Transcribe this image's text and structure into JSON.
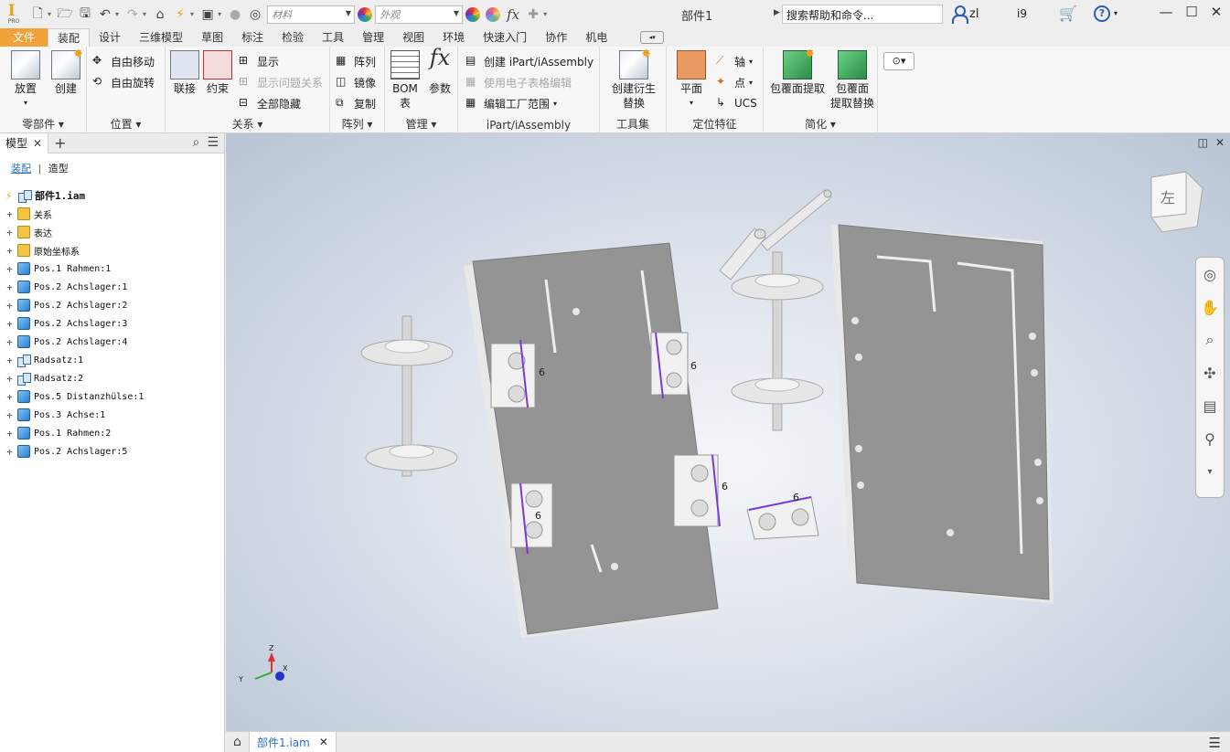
{
  "titlebar": {
    "logo_text": "I",
    "logo_sub": "PRO",
    "material_placeholder": "材料",
    "appearance_placeholder": "外观",
    "doc_title": "部件1",
    "search_placeholder": "搜索帮助和命令...",
    "user_name": "zl",
    "user_extra": "i9",
    "help": "?"
  },
  "tabs": [
    "文件",
    "装配",
    "设计",
    "三维模型",
    "草图",
    "标注",
    "检验",
    "工具",
    "管理",
    "视图",
    "环境",
    "快速入门",
    "协作",
    "机电"
  ],
  "active_tab": "装配",
  "ribbon": {
    "component": {
      "label": "零部件",
      "place": "放置",
      "create": "创建"
    },
    "position": {
      "label": "位置",
      "free_move": "自由移动",
      "free_rotate": "自由旋转"
    },
    "relations": {
      "label": "关系",
      "join": "联接",
      "constrain": "约束",
      "show": "显示",
      "show_problem": "显示问题关系",
      "hide_all": "全部隐藏"
    },
    "pattern": {
      "label": "阵列",
      "pattern": "阵列",
      "mirror": "镜像",
      "copy": "复制"
    },
    "manage": {
      "label": "管理",
      "bom": "BOM",
      "bom2": "表",
      "param": "参数"
    },
    "ipart": {
      "label": "iPart/iAssembly",
      "create": "创建 iPart/iAssembly",
      "sheet_edit": "使用电子表格编辑",
      "factory": "编辑工厂范围"
    },
    "toolset": {
      "label": "工具集",
      "derive": "创建衍生",
      "replace": "替换"
    },
    "work_features": {
      "label": "定位特征",
      "plane": "平面",
      "axis": "轴",
      "point": "点",
      "ucs": "UCS"
    },
    "simplify": {
      "label": "简化",
      "shrinkwrap": "包覆面提取",
      "shrinkwrap_sub1": "包覆面",
      "shrinkwrap_sub2": "提取替换"
    }
  },
  "browser": {
    "tab_label": "模型",
    "filter_assembly": "装配",
    "filter_model": "造型",
    "root": "部件1.iam",
    "items": [
      {
        "label": "关系",
        "type": "folder"
      },
      {
        "label": "表达",
        "type": "folder"
      },
      {
        "label": "原始坐标系",
        "type": "folder"
      },
      {
        "label": "Pos.1 Rahmen:1",
        "type": "part"
      },
      {
        "label": "Pos.2 Achslager:1",
        "type": "part"
      },
      {
        "label": "Pos.2 Achslager:2",
        "type": "part"
      },
      {
        "label": "Pos.2 Achslager:3",
        "type": "part"
      },
      {
        "label": "Pos.2 Achslager:4",
        "type": "part"
      },
      {
        "label": "Radsatz:1",
        "type": "asm"
      },
      {
        "label": "Radsatz:2",
        "type": "asm"
      },
      {
        "label": "Pos.5 Distanzhülse:1",
        "type": "part"
      },
      {
        "label": "Pos.3 Achse:1",
        "type": "part"
      },
      {
        "label": "Pos.1 Rahmen:2",
        "type": "part"
      },
      {
        "label": "Pos.2 Achslager:5",
        "type": "part"
      }
    ]
  },
  "viewport": {
    "viewcube_label": "左",
    "dimension_label": "6",
    "triad": {
      "x": "X",
      "y": "Y",
      "z": "Z"
    }
  },
  "bottom": {
    "doc_tab": "部件1.iam"
  }
}
